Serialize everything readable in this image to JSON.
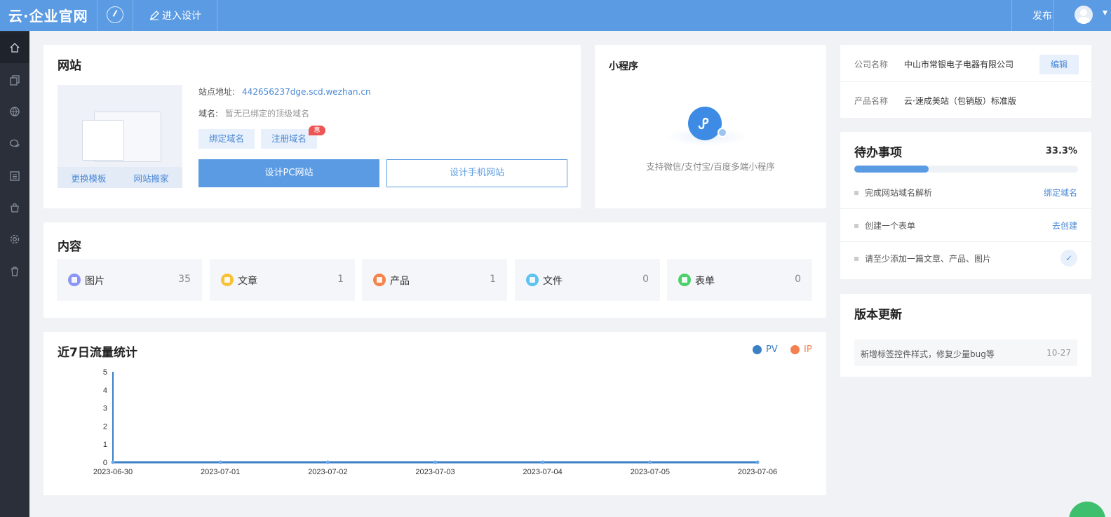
{
  "topbar": {
    "logo": "云·企业官网",
    "design_label": "进入设计",
    "publish_label": "发布"
  },
  "website": {
    "title": "网站",
    "thumb_actions": [
      "更换模板",
      "网站搬家"
    ],
    "site_label": "站点地址:",
    "site_value": "442656237dge.scd.wezhan.cn",
    "domain_label": "域名:",
    "domain_value": "暂无已绑定的顶级域名",
    "bind_domain": "绑定域名",
    "register_domain": "注册域名",
    "hui_badge": "惠",
    "design_pc": "设计PC网站",
    "design_mobile": "设计手机网站"
  },
  "miniprogram": {
    "title": "小程序",
    "desc": "支持微信/支付宝/百度多端小程序"
  },
  "company": {
    "name_label": "公司名称",
    "name_value": "中山市常银电子电器有限公司",
    "edit_label": "编辑",
    "product_label": "产品名称",
    "product_value": "云·速成美站（包销版）标准版"
  },
  "todo": {
    "title": "待办事项",
    "percent_text": "33.3%",
    "progress": 0.333,
    "items": [
      {
        "text": "完成网站域名解析",
        "action": "绑定域名"
      },
      {
        "text": "创建一个表单",
        "action": "去创建"
      },
      {
        "text": "请至少添加一篇文章、产品、图片",
        "done": true
      }
    ]
  },
  "update": {
    "title": "版本更新",
    "text": "新增标签控件样式，修复少量bug等",
    "date": "10-27"
  },
  "content": {
    "title": "内容",
    "tiles": [
      {
        "label": "图片",
        "count": "35",
        "color": "#8b95f5"
      },
      {
        "label": "文章",
        "count": "1",
        "color": "#f7c23a"
      },
      {
        "label": "产品",
        "count": "1",
        "color": "#f5844a"
      },
      {
        "label": "文件",
        "count": "0",
        "color": "#5ec4ef"
      },
      {
        "label": "表单",
        "count": "0",
        "color": "#4cd06a"
      }
    ]
  },
  "traffic": {
    "title": "近7日流量统计"
  },
  "chart_data": {
    "type": "line",
    "x": [
      "2023-06-30",
      "2023-07-01",
      "2023-07-02",
      "2023-07-03",
      "2023-07-04",
      "2023-07-05",
      "2023-07-06"
    ],
    "series": [
      {
        "name": "PV",
        "values": [
          0,
          0,
          0,
          0,
          0,
          0,
          0
        ],
        "color": "#3b7fc4"
      },
      {
        "name": "IP",
        "values": [
          0,
          0,
          0,
          0,
          0,
          0,
          0
        ],
        "color": "#f5804f"
      }
    ],
    "yticks": [
      0,
      1,
      2,
      3,
      4,
      5
    ],
    "ylim": [
      0,
      5
    ],
    "legend": "top-right",
    "grid": false
  }
}
